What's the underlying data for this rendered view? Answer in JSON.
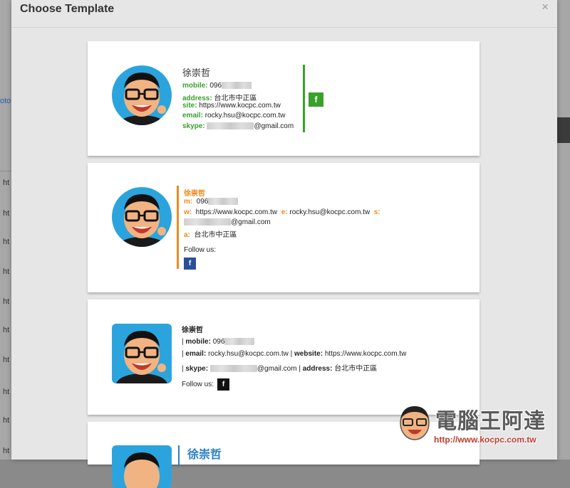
{
  "background": {
    "left_rows": [
      "ht",
      "ht",
      "ht",
      "ht",
      "ht",
      "ht",
      "ht",
      "ht",
      "ht",
      "ht",
      "ht"
    ],
    "left_link": "oto"
  },
  "modal": {
    "title": "Choose Template",
    "close_label": "×"
  },
  "templates": {
    "t1": {
      "name": "徐崇哲",
      "mobile_label": "mobile:",
      "mobile_value": "096",
      "address_label": "address:",
      "address_value": "台北市中正區",
      "site_label": "site:",
      "site_value": "https://www.kocpc.com.tw",
      "email_label": "email:",
      "email_value": "rocky.hsu@kocpc.com.tw",
      "skype_label": "skype:",
      "skype_value": "@gmail.com",
      "facebook_icon": "f",
      "accent": "#3aa02c"
    },
    "t2": {
      "name": "徐崇哲",
      "m_label": "m:",
      "m_value": "096",
      "w_label": "w:",
      "w_value": "https://www.kocpc.com.tw",
      "e_label": "e:",
      "e_value": "rocky.hsu@kocpc.com.tw",
      "s_label": "s:",
      "s_value": "@gmail.com",
      "a_label": "a:",
      "a_value": "台北市中正區",
      "follow_label": "Follow us:",
      "facebook_icon": "f",
      "accent": "#ef8a1e"
    },
    "t3": {
      "name": "徐崇哲",
      "sep": "|",
      "mobile_label": "mobile:",
      "mobile_value": "096",
      "email_label": "email:",
      "email_value": "rocky.hsu@kocpc.com.tw",
      "website_label": "website:",
      "website_value": "https://www.kocpc.com.tw",
      "skype_label": "skype:",
      "skype_value": "@gmail.com",
      "address_label": "address:",
      "address_value": "台北市中正區",
      "follow_label": "Follow us:",
      "facebook_icon": "f"
    },
    "t4": {
      "name": "徐崇哲",
      "accent": "#2a7fc4"
    }
  },
  "watermark": {
    "text": "電腦王阿達",
    "url": "http://www.kocpc.com.tw"
  }
}
